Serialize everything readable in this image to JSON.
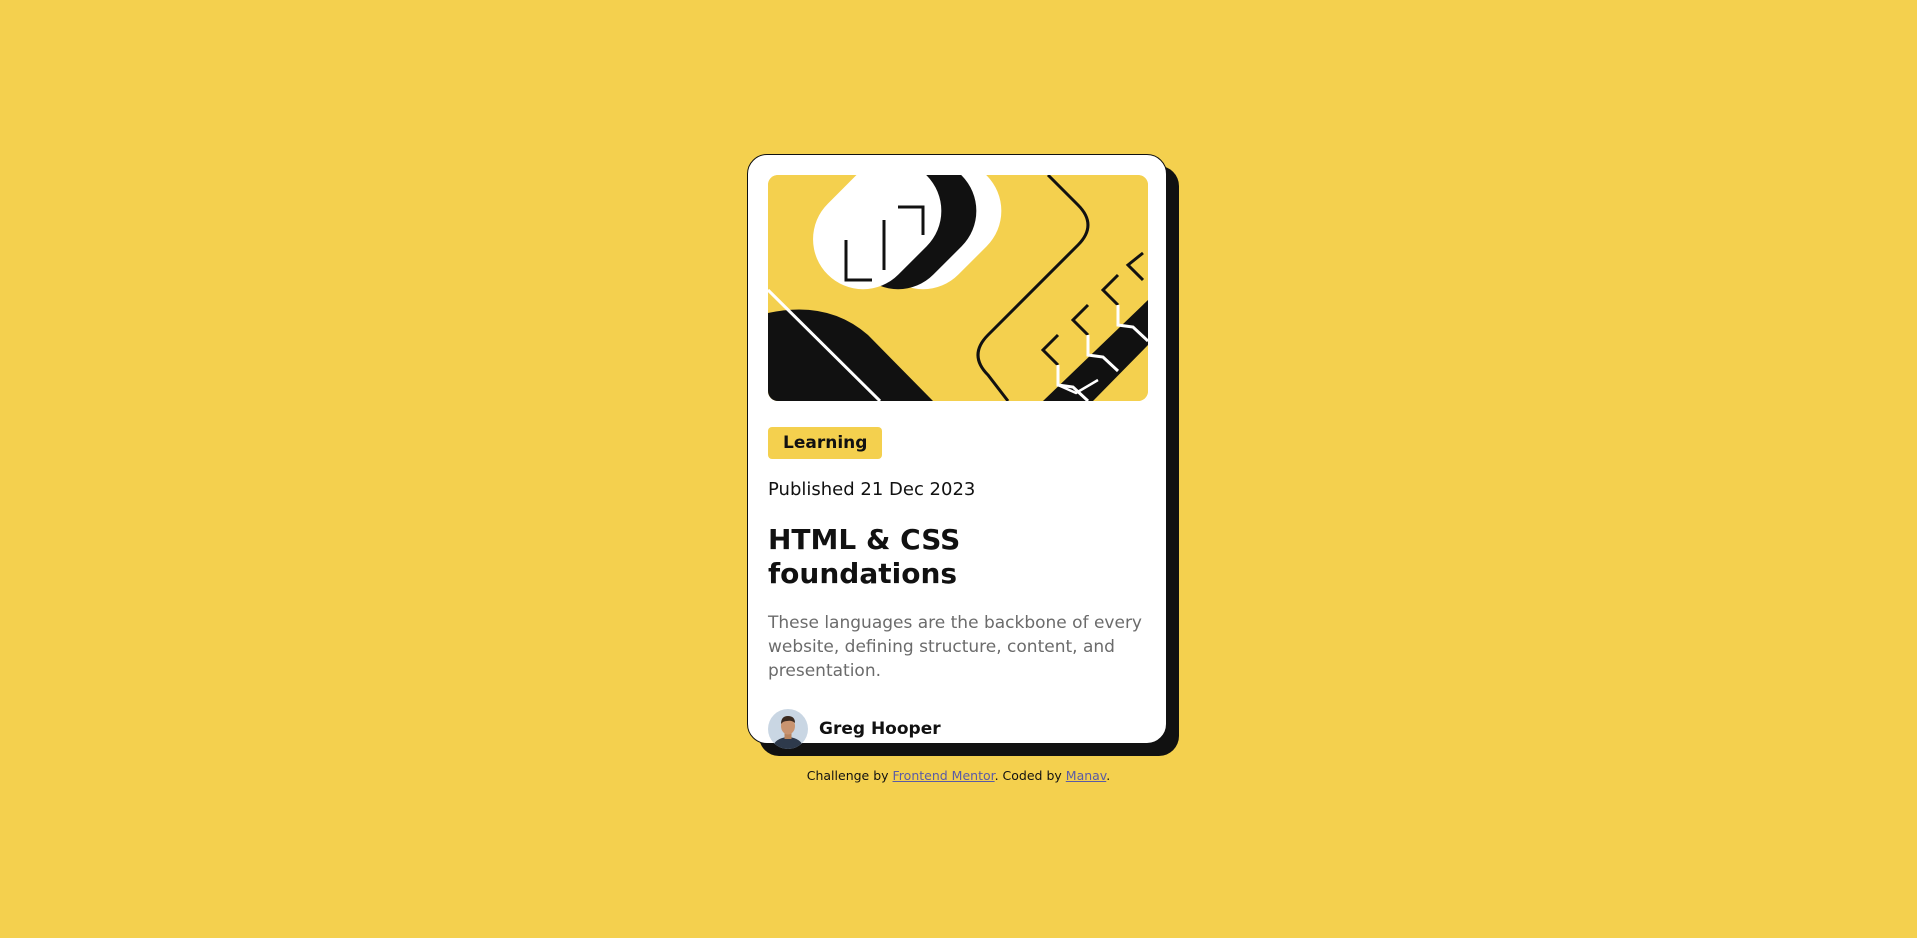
{
  "colors": {
    "background": "#F4D04E",
    "card": "#FFFFFF",
    "ink": "#111111",
    "muted": "#6B6B6B",
    "link": "#5B5BA5"
  },
  "card": {
    "hero_image_icon": "abstract-illustration-icon",
    "tag": "Learning",
    "published": "Published 21 Dec 2023",
    "title": "HTML & CSS foundations",
    "description": "These languages are the backbone of every website, defining structure, content, and presentation.",
    "author": {
      "name": "Greg Hooper",
      "avatar_icon": "avatar-icon"
    }
  },
  "attribution": {
    "prefix": "Challenge by ",
    "frontend_mentor_link": "Frontend Mentor",
    "middle": ". Coded by ",
    "author_link": "Manav",
    "suffix": "."
  }
}
